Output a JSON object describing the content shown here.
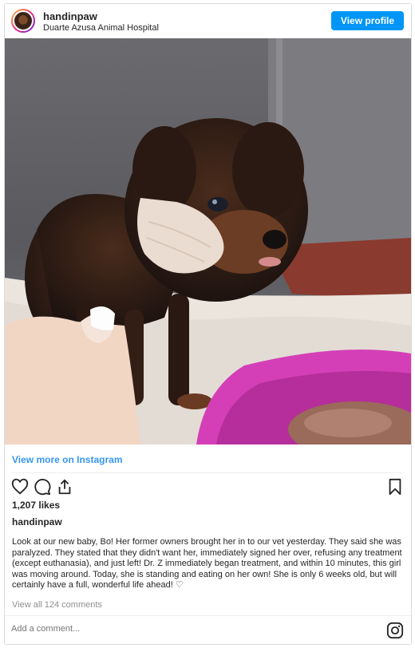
{
  "post": {
    "username": "handinpaw",
    "location": "Duarte Azusa Animal Hospital",
    "view_profile_label": "View profile",
    "view_more_label": "View more on Instagram",
    "likes": "1,207 likes",
    "caption_username": "handinpaw",
    "caption": "Look at our new baby, Bo! Her former owners brought her in to our vet yesterday. They said she was paralyzed. They stated that they didn't want her, immediately signed her over, refusing any treatment (except euthanasia), and just left! Dr. Z immediately began treatment, and within 10 minutes, this girl was moving around. Today, she is standing and eating on her own! She is only 6 weeks old, but will certainly have a full, wonderful life ahead! ♡",
    "view_comments_label": "View all 124 comments",
    "comment_placeholder": "Add a comment..."
  },
  "icons": {
    "like": "heart-icon",
    "comment": "comment-icon",
    "share": "share-icon",
    "save": "bookmark-icon",
    "instagram": "instagram-icon"
  },
  "colors": {
    "accent": "#0095f6",
    "link": "#3897f0",
    "muted": "#8e8e8e",
    "text": "#262626",
    "border": "#dbdbdb"
  }
}
